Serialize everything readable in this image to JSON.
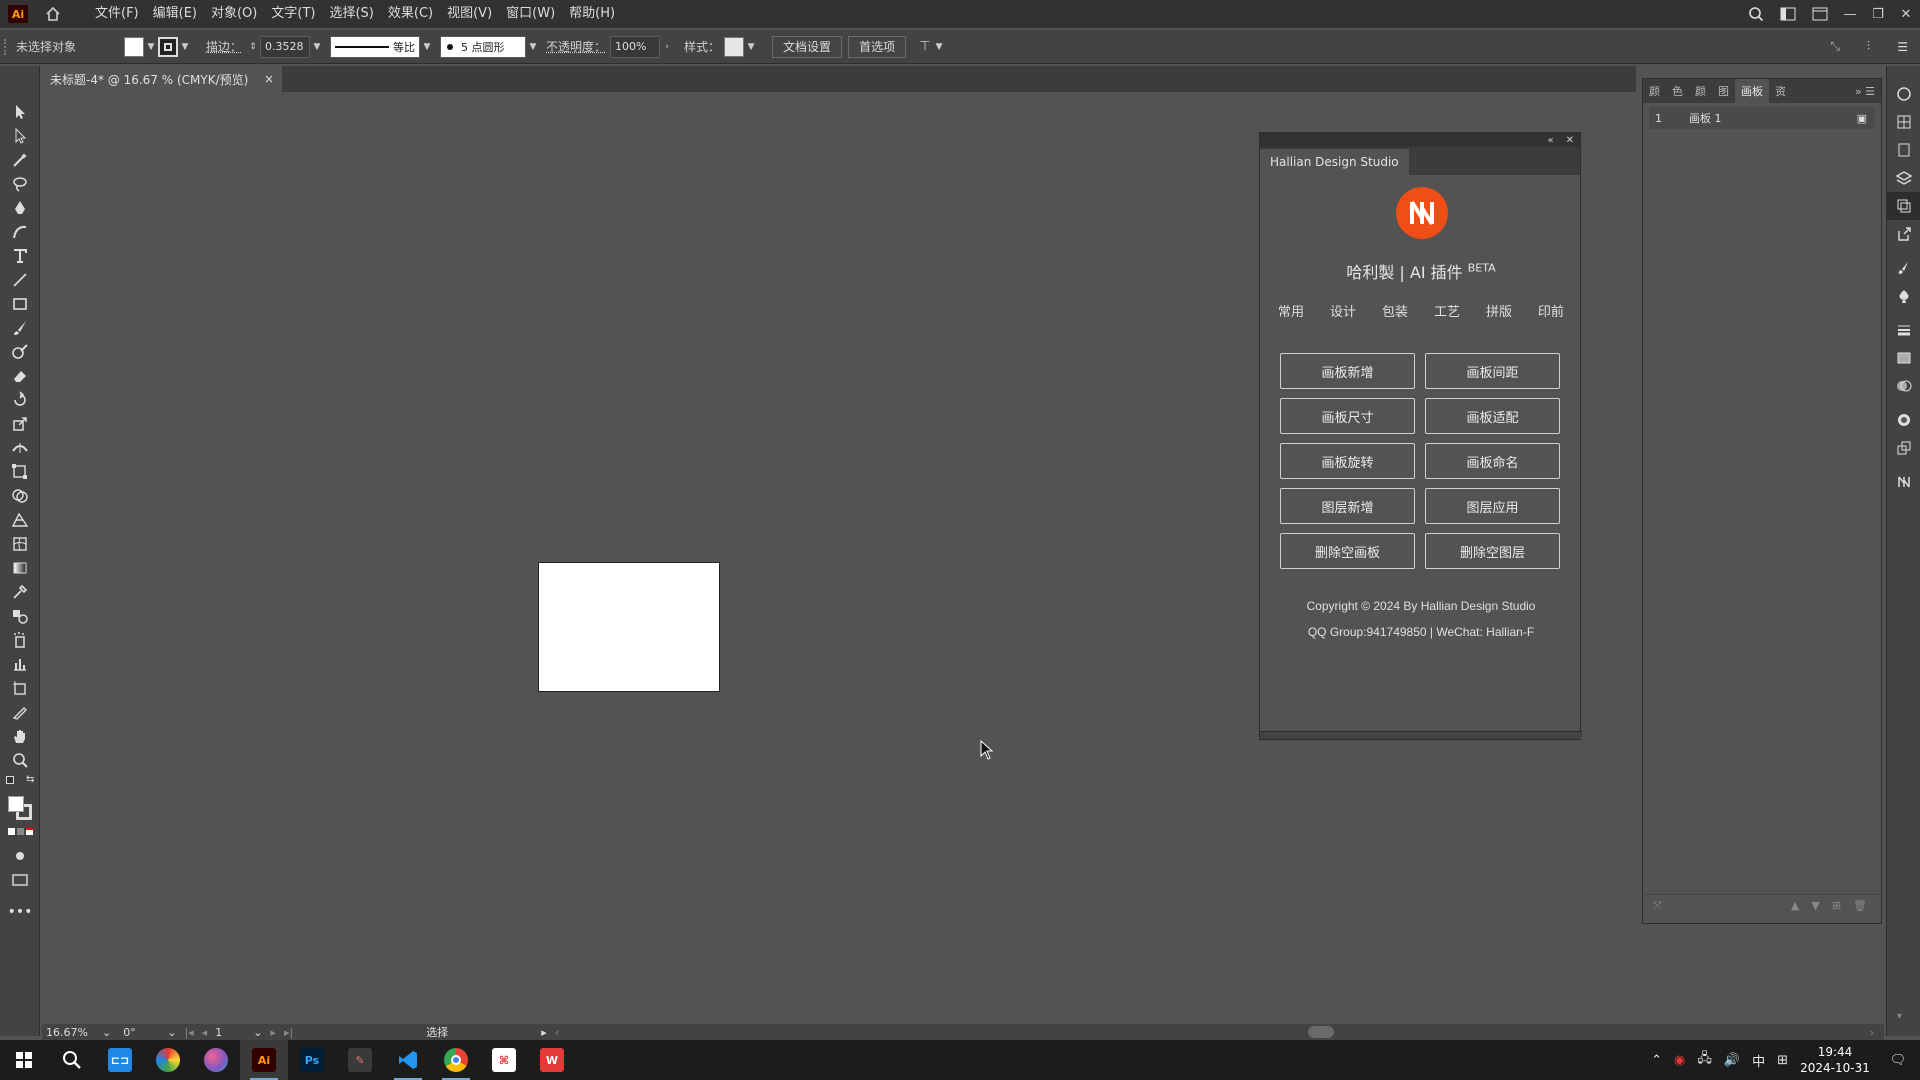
{
  "menubar": {
    "app_badge": "Ai",
    "items": [
      "文件(F)",
      "编辑(E)",
      "对象(O)",
      "文字(T)",
      "选择(S)",
      "效果(C)",
      "视图(V)",
      "窗口(W)",
      "帮助(H)"
    ]
  },
  "controlbar": {
    "selection_status": "未选择对象",
    "stroke_label": "描边：",
    "stroke_value": "0.3528",
    "line_profile": "等比",
    "brush_label": "5 点圆形",
    "opacity_label": "不透明度：",
    "opacity_value": "100%",
    "style_label": "样式：",
    "doc_setup_button": "文档设置",
    "preferences_button": "首选项"
  },
  "document": {
    "tab_title": "未标题-4* @ 16.67 % (CMYK/预览)"
  },
  "plugin": {
    "tab_title": "Hallian Design Studio",
    "brand_text": "哈利製 | AI 插件",
    "brand_badge": "BETA",
    "nav": [
      "常用",
      "设计",
      "包装",
      "工艺",
      "拼版",
      "印前"
    ],
    "buttons": [
      "画板新增",
      "画板间距",
      "画板尺寸",
      "画板适配",
      "画板旋转",
      "画板命名",
      "图层新增",
      "图层应用",
      "删除空画板",
      "删除空图层"
    ],
    "copyright": "Copyright © 2024 By Hallian Design Studio",
    "contact": "QQ Group:941749850 | WeChat: Hallian-F",
    "accent_color": "#f04e17"
  },
  "artboards_panel": {
    "tabs": [
      "颜",
      "色",
      "颜",
      "图",
      "画板",
      "资"
    ],
    "rows": [
      {
        "index": "1",
        "name": "画板 1"
      }
    ]
  },
  "statusbar": {
    "zoom": "16.67%",
    "rotation": "0°",
    "page": "1",
    "tool": "选择"
  },
  "taskbar": {
    "apps": [
      {
        "name": "start-icon"
      },
      {
        "name": "search-icon"
      },
      {
        "name": "app-icon-1"
      },
      {
        "name": "app-icon-2"
      },
      {
        "name": "app-icon-3"
      },
      {
        "name": "illustrator-icon",
        "label": "Ai"
      },
      {
        "name": "photoshop-icon",
        "label": "Ps"
      },
      {
        "name": "app-icon-4"
      },
      {
        "name": "vscode-icon"
      },
      {
        "name": "chrome-icon"
      },
      {
        "name": "acrobat-icon"
      },
      {
        "name": "wps-icon",
        "label": "W"
      }
    ],
    "ime": "中",
    "time": "19:44",
    "date": "2024-10-31"
  }
}
